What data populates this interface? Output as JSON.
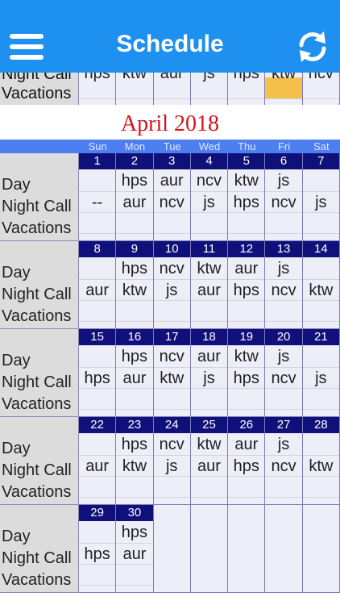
{
  "header": {
    "title": "Schedule",
    "menu_icon": "hamburger-menu-icon",
    "refresh_icon": "refresh-icon",
    "color": "#1e90f0"
  },
  "previous_month": {
    "night_call_label": "Night Call",
    "vacations_label": "Vacations",
    "night_values": [
      "hps",
      "ktw",
      "aur",
      "js",
      "hps",
      "ktw",
      "ncv"
    ]
  },
  "calendar": {
    "month_title": "April 2018",
    "weekdays": [
      "Sun",
      "Mon",
      "Tue",
      "Wed",
      "Thu",
      "Fri",
      "Sat"
    ],
    "row_labels": {
      "day": "Day",
      "night": "Night Call",
      "vacations": "Vacations"
    },
    "weeks": [
      [
        {
          "date": "1",
          "day": "",
          "night": "--"
        },
        {
          "date": "2",
          "day": "hps",
          "night": "aur"
        },
        {
          "date": "3",
          "day": "aur",
          "night": "ncv"
        },
        {
          "date": "4",
          "day": "ncv",
          "night": "js"
        },
        {
          "date": "5",
          "day": "ktw",
          "night": "hps"
        },
        {
          "date": "6",
          "day": "js",
          "night": "ncv"
        },
        {
          "date": "7",
          "day": "",
          "night": "js"
        }
      ],
      [
        {
          "date": "8",
          "day": "",
          "night": "aur"
        },
        {
          "date": "9",
          "day": "hps",
          "night": "ktw"
        },
        {
          "date": "10",
          "day": "ncv",
          "night": "js"
        },
        {
          "date": "11",
          "day": "ktw",
          "night": "aur"
        },
        {
          "date": "12",
          "day": "aur",
          "night": "hps"
        },
        {
          "date": "13",
          "day": "js",
          "night": "ncv"
        },
        {
          "date": "14",
          "day": "",
          "night": "ktw"
        }
      ],
      [
        {
          "date": "15",
          "day": "",
          "night": "hps"
        },
        {
          "date": "16",
          "day": "hps",
          "night": "aur"
        },
        {
          "date": "17",
          "day": "ncv",
          "night": "ktw"
        },
        {
          "date": "18",
          "day": "aur",
          "night": "js"
        },
        {
          "date": "19",
          "day": "ktw",
          "night": "hps"
        },
        {
          "date": "20",
          "day": "js",
          "night": "ncv"
        },
        {
          "date": "21",
          "day": "",
          "night": "js"
        }
      ],
      [
        {
          "date": "22",
          "day": "",
          "night": "aur"
        },
        {
          "date": "23",
          "day": "hps",
          "night": "ktw"
        },
        {
          "date": "24",
          "day": "ncv",
          "night": "js"
        },
        {
          "date": "25",
          "day": "ktw",
          "night": "aur"
        },
        {
          "date": "26",
          "day": "aur",
          "night": "hps"
        },
        {
          "date": "27",
          "day": "js",
          "night": "ncv"
        },
        {
          "date": "28",
          "day": "",
          "night": "ktw"
        }
      ],
      [
        {
          "date": "29",
          "day": "",
          "night": "hps"
        },
        {
          "date": "30",
          "day": "hps",
          "night": "aur"
        },
        null,
        null,
        null,
        null,
        null
      ]
    ]
  }
}
